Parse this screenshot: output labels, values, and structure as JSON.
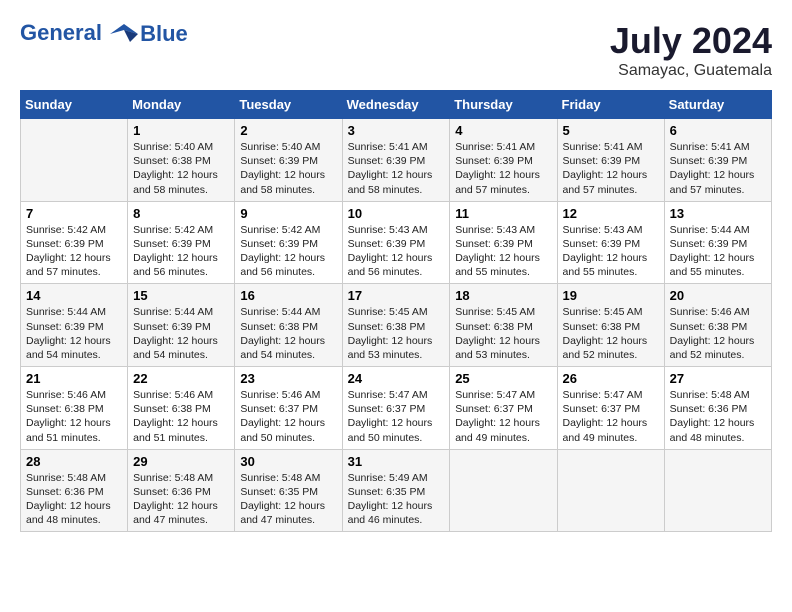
{
  "header": {
    "logo_line1": "General",
    "logo_line2": "Blue",
    "month_year": "July 2024",
    "location": "Samayac, Guatemala"
  },
  "weekdays": [
    "Sunday",
    "Monday",
    "Tuesday",
    "Wednesday",
    "Thursday",
    "Friday",
    "Saturday"
  ],
  "weeks": [
    [
      {
        "day": "",
        "info": ""
      },
      {
        "day": "1",
        "info": "Sunrise: 5:40 AM\nSunset: 6:38 PM\nDaylight: 12 hours\nand 58 minutes."
      },
      {
        "day": "2",
        "info": "Sunrise: 5:40 AM\nSunset: 6:39 PM\nDaylight: 12 hours\nand 58 minutes."
      },
      {
        "day": "3",
        "info": "Sunrise: 5:41 AM\nSunset: 6:39 PM\nDaylight: 12 hours\nand 58 minutes."
      },
      {
        "day": "4",
        "info": "Sunrise: 5:41 AM\nSunset: 6:39 PM\nDaylight: 12 hours\nand 57 minutes."
      },
      {
        "day": "5",
        "info": "Sunrise: 5:41 AM\nSunset: 6:39 PM\nDaylight: 12 hours\nand 57 minutes."
      },
      {
        "day": "6",
        "info": "Sunrise: 5:41 AM\nSunset: 6:39 PM\nDaylight: 12 hours\nand 57 minutes."
      }
    ],
    [
      {
        "day": "7",
        "info": "Sunrise: 5:42 AM\nSunset: 6:39 PM\nDaylight: 12 hours\nand 57 minutes."
      },
      {
        "day": "8",
        "info": "Sunrise: 5:42 AM\nSunset: 6:39 PM\nDaylight: 12 hours\nand 56 minutes."
      },
      {
        "day": "9",
        "info": "Sunrise: 5:42 AM\nSunset: 6:39 PM\nDaylight: 12 hours\nand 56 minutes."
      },
      {
        "day": "10",
        "info": "Sunrise: 5:43 AM\nSunset: 6:39 PM\nDaylight: 12 hours\nand 56 minutes."
      },
      {
        "day": "11",
        "info": "Sunrise: 5:43 AM\nSunset: 6:39 PM\nDaylight: 12 hours\nand 55 minutes."
      },
      {
        "day": "12",
        "info": "Sunrise: 5:43 AM\nSunset: 6:39 PM\nDaylight: 12 hours\nand 55 minutes."
      },
      {
        "day": "13",
        "info": "Sunrise: 5:44 AM\nSunset: 6:39 PM\nDaylight: 12 hours\nand 55 minutes."
      }
    ],
    [
      {
        "day": "14",
        "info": "Sunrise: 5:44 AM\nSunset: 6:39 PM\nDaylight: 12 hours\nand 54 minutes."
      },
      {
        "day": "15",
        "info": "Sunrise: 5:44 AM\nSunset: 6:39 PM\nDaylight: 12 hours\nand 54 minutes."
      },
      {
        "day": "16",
        "info": "Sunrise: 5:44 AM\nSunset: 6:38 PM\nDaylight: 12 hours\nand 54 minutes."
      },
      {
        "day": "17",
        "info": "Sunrise: 5:45 AM\nSunset: 6:38 PM\nDaylight: 12 hours\nand 53 minutes."
      },
      {
        "day": "18",
        "info": "Sunrise: 5:45 AM\nSunset: 6:38 PM\nDaylight: 12 hours\nand 53 minutes."
      },
      {
        "day": "19",
        "info": "Sunrise: 5:45 AM\nSunset: 6:38 PM\nDaylight: 12 hours\nand 52 minutes."
      },
      {
        "day": "20",
        "info": "Sunrise: 5:46 AM\nSunset: 6:38 PM\nDaylight: 12 hours\nand 52 minutes."
      }
    ],
    [
      {
        "day": "21",
        "info": "Sunrise: 5:46 AM\nSunset: 6:38 PM\nDaylight: 12 hours\nand 51 minutes."
      },
      {
        "day": "22",
        "info": "Sunrise: 5:46 AM\nSunset: 6:38 PM\nDaylight: 12 hours\nand 51 minutes."
      },
      {
        "day": "23",
        "info": "Sunrise: 5:46 AM\nSunset: 6:37 PM\nDaylight: 12 hours\nand 50 minutes."
      },
      {
        "day": "24",
        "info": "Sunrise: 5:47 AM\nSunset: 6:37 PM\nDaylight: 12 hours\nand 50 minutes."
      },
      {
        "day": "25",
        "info": "Sunrise: 5:47 AM\nSunset: 6:37 PM\nDaylight: 12 hours\nand 49 minutes."
      },
      {
        "day": "26",
        "info": "Sunrise: 5:47 AM\nSunset: 6:37 PM\nDaylight: 12 hours\nand 49 minutes."
      },
      {
        "day": "27",
        "info": "Sunrise: 5:48 AM\nSunset: 6:36 PM\nDaylight: 12 hours\nand 48 minutes."
      }
    ],
    [
      {
        "day": "28",
        "info": "Sunrise: 5:48 AM\nSunset: 6:36 PM\nDaylight: 12 hours\nand 48 minutes."
      },
      {
        "day": "29",
        "info": "Sunrise: 5:48 AM\nSunset: 6:36 PM\nDaylight: 12 hours\nand 47 minutes."
      },
      {
        "day": "30",
        "info": "Sunrise: 5:48 AM\nSunset: 6:35 PM\nDaylight: 12 hours\nand 47 minutes."
      },
      {
        "day": "31",
        "info": "Sunrise: 5:49 AM\nSunset: 6:35 PM\nDaylight: 12 hours\nand 46 minutes."
      },
      {
        "day": "",
        "info": ""
      },
      {
        "day": "",
        "info": ""
      },
      {
        "day": "",
        "info": ""
      }
    ]
  ]
}
